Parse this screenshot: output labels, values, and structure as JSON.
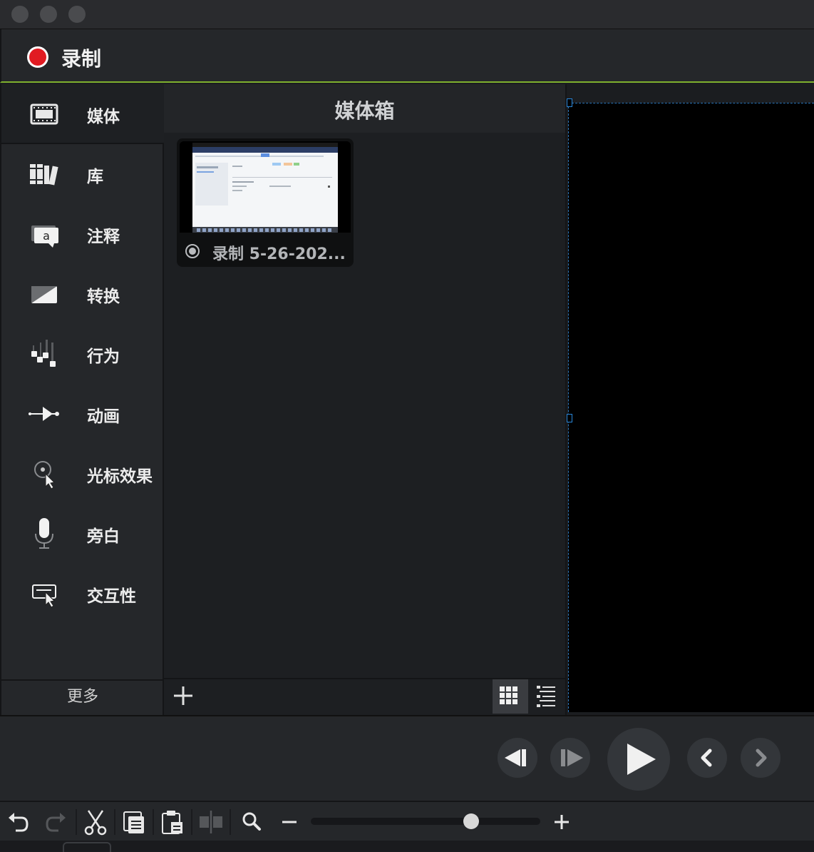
{
  "window": {
    "traffic_lights": [
      "close",
      "minimize",
      "zoom"
    ]
  },
  "record": {
    "label": "录制",
    "icon": "record-dot-icon",
    "accent": "#e11b22"
  },
  "sidebar": {
    "items": [
      {
        "label": "媒体",
        "icon": "film-strip-icon",
        "active": true
      },
      {
        "label": "库",
        "icon": "library-books-icon"
      },
      {
        "label": "注释",
        "icon": "annotation-speech-icon"
      },
      {
        "label": "转换",
        "icon": "transition-icon"
      },
      {
        "label": "行为",
        "icon": "behaviors-icon"
      },
      {
        "label": "动画",
        "icon": "animation-arrow-icon"
      },
      {
        "label": "光标效果",
        "icon": "cursor-effect-icon"
      },
      {
        "label": "旁白",
        "icon": "microphone-icon"
      },
      {
        "label": "交互性",
        "icon": "interactivity-icon"
      }
    ],
    "more_label": "更多"
  },
  "media_bin": {
    "title": "媒体箱",
    "items": [
      {
        "label": "录制 5-26-202...",
        "type": "recording"
      }
    ],
    "add_icon": "plus-icon",
    "view_modes": [
      "grid-view-icon",
      "list-view-icon"
    ],
    "active_view": "grid"
  },
  "playback": {
    "buttons": [
      "step-back-icon",
      "step-forward-icon",
      "play-icon",
      "previous-icon",
      "next-icon"
    ]
  },
  "timeline_toolbar": {
    "buttons": [
      "undo-icon",
      "redo-icon",
      "cut-icon",
      "copy-icon",
      "paste-icon",
      "split-icon",
      "zoom-search-icon",
      "zoom-out-icon",
      "zoom-in-icon"
    ],
    "zoom_level": 0.7
  },
  "colors": {
    "accent_green": "#7fb02e",
    "selection_blue": "#2a86d8"
  }
}
